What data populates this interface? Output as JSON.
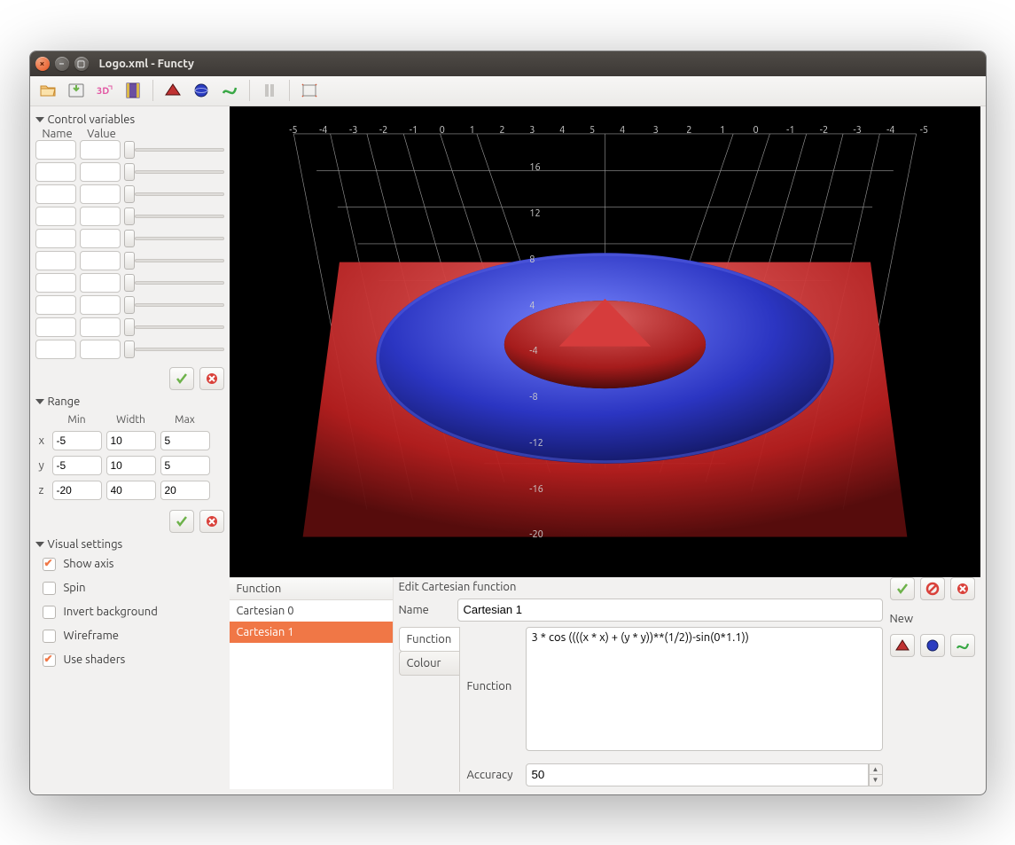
{
  "window": {
    "title": "Logo.xml - Functy"
  },
  "toolbar_icons": [
    "open",
    "save",
    "export-3d",
    "export-anim",
    "surface-cartesian",
    "surface-sphere",
    "surface-curve",
    "pause",
    "fullscreen"
  ],
  "panels": {
    "control_variables": {
      "title": "Control variables",
      "headers": {
        "name": "Name",
        "value": "Value"
      },
      "rows": [
        {
          "name": "",
          "value": ""
        },
        {
          "name": "",
          "value": ""
        },
        {
          "name": "",
          "value": ""
        },
        {
          "name": "",
          "value": ""
        },
        {
          "name": "",
          "value": ""
        },
        {
          "name": "",
          "value": ""
        },
        {
          "name": "",
          "value": ""
        },
        {
          "name": "",
          "value": ""
        },
        {
          "name": "",
          "value": ""
        },
        {
          "name": "",
          "value": ""
        }
      ]
    },
    "range": {
      "title": "Range",
      "headers": {
        "min": "Min",
        "width": "Width",
        "max": "Max"
      },
      "rows": {
        "x": {
          "label": "x",
          "min": "-5",
          "width": "10",
          "max": "5"
        },
        "y": {
          "label": "y",
          "min": "-5",
          "width": "10",
          "max": "5"
        },
        "z": {
          "label": "z",
          "min": "-20",
          "width": "40",
          "max": "20"
        }
      }
    },
    "visual": {
      "title": "Visual settings",
      "options": {
        "show_axis": {
          "label": "Show axis",
          "checked": true
        },
        "spin": {
          "label": "Spin",
          "checked": false
        },
        "invert_bg": {
          "label": "Invert background",
          "checked": false
        },
        "wireframe": {
          "label": "Wireframe",
          "checked": false
        },
        "use_shaders": {
          "label": "Use shaders",
          "checked": true
        }
      }
    }
  },
  "viewport": {
    "top_ticks_left": [
      "-5",
      "-4",
      "-3",
      "-2",
      "-1",
      "0",
      "1",
      "2",
      "3",
      "4",
      "5"
    ],
    "top_ticks_right": [
      "4",
      "3",
      "2",
      "1",
      "0",
      "-1",
      "-2",
      "-3",
      "-4",
      "-5"
    ],
    "z_ticks": [
      "16",
      "12",
      "8",
      "4",
      "-4",
      "-8",
      "-12",
      "-16",
      "-20"
    ]
  },
  "functions": {
    "header": "Function",
    "items": [
      "Cartesian 0",
      "Cartesian 1"
    ],
    "selected_index": 1
  },
  "editor": {
    "title": "Edit Cartesian function",
    "name_label": "Name",
    "name_value": "Cartesian 1",
    "tabs": {
      "function": "Function",
      "colour": "Colour"
    },
    "function_label": "Function",
    "function_value": "3 * cos ((((x * x) + (y * y))**(1/2))-sin(0*1.1))",
    "accuracy_label": "Accuracy",
    "accuracy_value": "50",
    "new_label": "New"
  }
}
